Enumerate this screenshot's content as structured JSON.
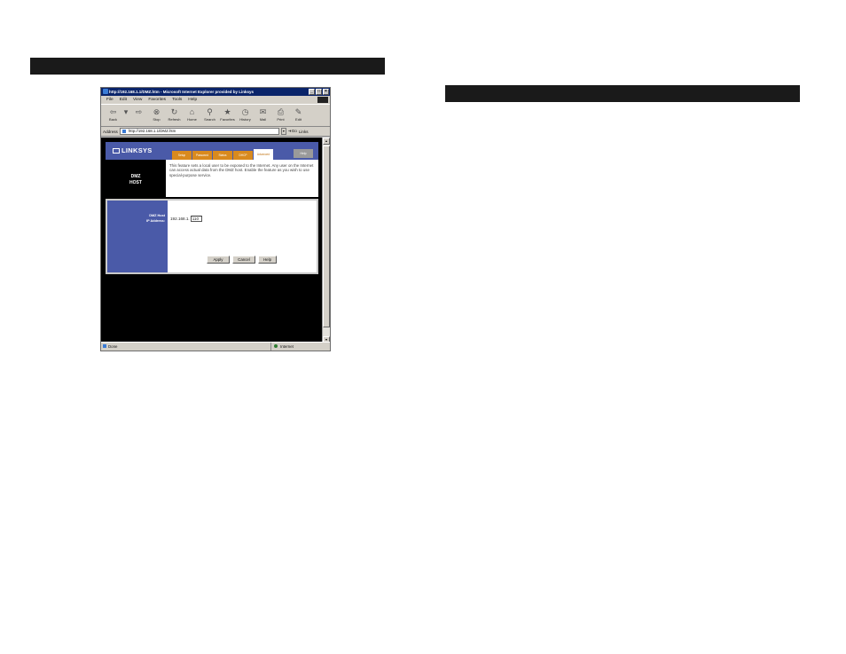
{
  "browser": {
    "title": "http://192.168.1.1/DMZ.htm - Microsoft Internet Explorer provided by Linksys",
    "window_controls": [
      "_",
      "□",
      "×"
    ],
    "menu": [
      "File",
      "Edit",
      "View",
      "Favorites",
      "Tools",
      "Help"
    ],
    "toolbar": [
      {
        "label": "Back",
        "icon": "back-arrow-icon",
        "glyph": "⇦"
      },
      {
        "label": "",
        "icon": "back-dropdown-icon",
        "glyph": "▾"
      },
      {
        "label": "",
        "icon": "forward-arrow-icon",
        "glyph": "⇨"
      },
      {
        "label": "Stop",
        "icon": "stop-icon",
        "glyph": "⊗"
      },
      {
        "label": "Refresh",
        "icon": "refresh-icon",
        "glyph": "↻"
      },
      {
        "label": "Home",
        "icon": "home-icon",
        "glyph": "⌂"
      },
      {
        "label": "Search",
        "icon": "search-icon",
        "glyph": "⚲"
      },
      {
        "label": "Favorites",
        "icon": "favorites-icon",
        "glyph": "★"
      },
      {
        "label": "History",
        "icon": "history-icon",
        "glyph": "◷"
      },
      {
        "label": "Mail",
        "icon": "mail-icon",
        "glyph": "✉"
      },
      {
        "label": "Print",
        "icon": "print-icon",
        "glyph": "⎙"
      },
      {
        "label": "Edit",
        "icon": "edit-icon",
        "glyph": "✎"
      }
    ],
    "address_label": "Address",
    "address_value": "http://192.168.1.1/DMZ.htm",
    "go_label": "Go",
    "links_label": "Links",
    "status_text": "Done",
    "zone_text": "Internet"
  },
  "linksys": {
    "logo": "LINKSYS",
    "tabs": [
      "Setup",
      "Password",
      "Status",
      "DHCP",
      "Advanced"
    ],
    "help_tab": "Help",
    "section_title_line1": "DMZ",
    "section_title_line2": "HOST",
    "description": "This feature sets a local user to be exposed to the Internet. Any user on the Internet can access actual data from the DMZ host. Enable the feature as you wish to use special-purpose service.",
    "field_label_line1": "DMZ Host",
    "field_label_line2": "IP Address:",
    "ip_prefix": "192.168.1.",
    "ip_value": "110",
    "buttons": {
      "apply": "Apply",
      "cancel": "Cancel",
      "help": "Help"
    }
  },
  "colors": {
    "linksys_blue": "#4a5aa8",
    "tab_orange": "#d98a1e",
    "ie_title_blue": "#0a246a",
    "section_bar": "#1a1a1a"
  }
}
